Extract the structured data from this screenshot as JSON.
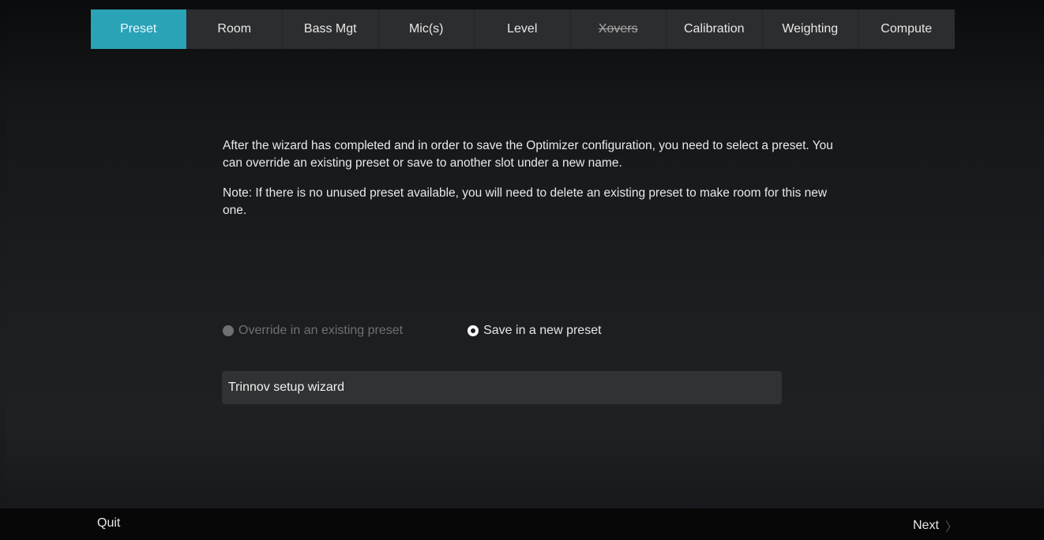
{
  "tabs": [
    {
      "label": "Preset",
      "state": "active"
    },
    {
      "label": "Room",
      "state": "normal"
    },
    {
      "label": "Bass Mgt",
      "state": "normal"
    },
    {
      "label": "Mic(s)",
      "state": "normal"
    },
    {
      "label": "Level",
      "state": "normal"
    },
    {
      "label": "Xovers",
      "state": "disabled"
    },
    {
      "label": "Calibration",
      "state": "normal"
    },
    {
      "label": "Weighting",
      "state": "normal"
    },
    {
      "label": "Compute",
      "state": "normal"
    }
  ],
  "content": {
    "paragraph1": "After the wizard has completed and in order to save the Optimizer configuration, you need to select a preset. You can override an existing preset or save to another slot under a new name.",
    "paragraph2": "Note: If there is no unused preset available, you will need to delete an existing preset to make room for this new one."
  },
  "options": {
    "override_label": "Override in an existing preset",
    "save_new_label": "Save in a new preset",
    "selected": "save_new"
  },
  "preset_name": {
    "value": "Trinnov setup wizard"
  },
  "footer": {
    "quit_label": "Quit",
    "next_label": "Next",
    "next_icon": "chevron-right-icon"
  },
  "colors": {
    "accent": "#2aa3b6"
  }
}
